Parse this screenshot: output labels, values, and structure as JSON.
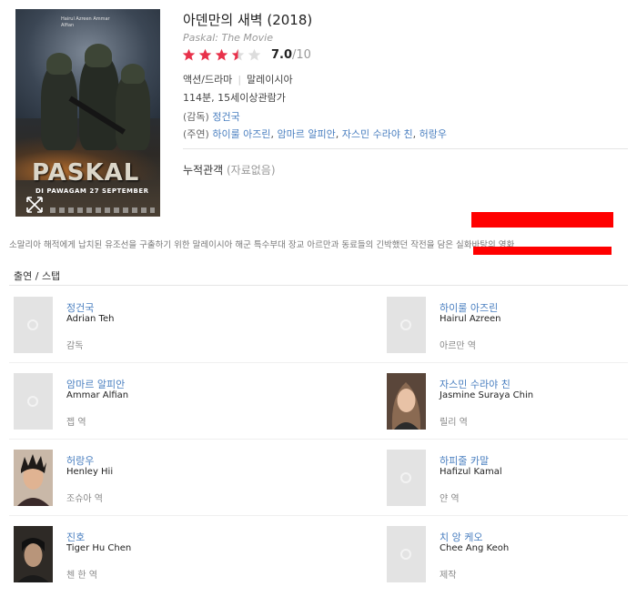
{
  "movie": {
    "title": "아덴만의 새벽 (2018)",
    "original_title": "Paskal: The Movie",
    "rating": {
      "score": "7.0",
      "max": "/10",
      "stars_value": 3.5,
      "stars_total": 5,
      "star_color": "#e8314a",
      "star_empty_color": "#dddddd"
    },
    "genres": "액션/드라마",
    "country": "말레이시아",
    "runtime_age": "114분, 15세이상관람가",
    "director_label": "(감독)",
    "director": "정건국",
    "cast_label": "(주연)",
    "cast": [
      "하이룰 아즈린",
      "암마르 알피안",
      "자스민 수라야 친",
      "허랑우"
    ],
    "cast_sep": ", ",
    "audience_label": "누적관객",
    "audience_value": "(자료없음)",
    "synopsis": "소말리아 해적에게 납치된 유조선을 구출하기 위한 말레이시아 해군 특수부대 장교 아르만과 동료들의 긴박했던 작전을 담은 실화바탕의 영화",
    "poster": {
      "title": "PASKAL",
      "date": "DI PAWAGAM 27 SEPTEMBER",
      "credits": "Hairul Azreen Ammar Alfian"
    }
  },
  "credits_section": {
    "title": "출연 / 스탭"
  },
  "people": [
    {
      "name": "정건국",
      "ename": "Adrian Teh",
      "role": "감독",
      "photo": "placeholder"
    },
    {
      "name": "하이룰 아즈린",
      "ename": "Hairul Azreen",
      "role": "아르만 역",
      "photo": "placeholder"
    },
    {
      "name": "암마르 알피안",
      "ename": "Ammar Alfian",
      "role": "젭 역",
      "photo": "placeholder"
    },
    {
      "name": "자스민 수라야 친",
      "ename": "Jasmine Suraya Chin",
      "role": "릴리 역",
      "photo": "woman"
    },
    {
      "name": "허랑우",
      "ename": "Henley Hii",
      "role": "조슈아 역",
      "photo": "man-spiky"
    },
    {
      "name": "하피줄 카말",
      "ename": "Hafizul Kamal",
      "role": "얀 역",
      "photo": "placeholder"
    },
    {
      "name": "진호",
      "ename": "Tiger Hu Chen",
      "role": "첸 한 역",
      "photo": "man-dark"
    },
    {
      "name": "치 앙 케오",
      "ename": "Chee Ang Keoh",
      "role": "제작",
      "photo": "placeholder"
    }
  ],
  "colors": {
    "link": "#4a7fc0",
    "redaction": "#ff0000"
  }
}
